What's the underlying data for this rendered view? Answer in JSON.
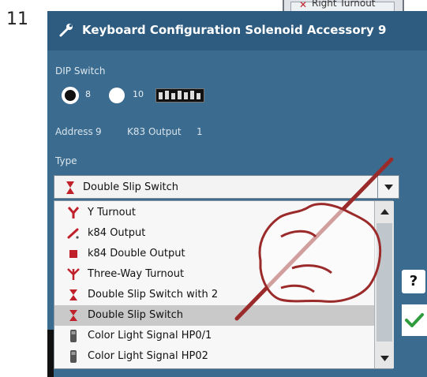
{
  "step_number": "11",
  "background_window": {
    "item_label": "Right Turnout"
  },
  "dialog": {
    "title": "Keyboard Configuration Solenoid Accessory 9",
    "dip_switch": {
      "label": "DIP Switch",
      "option_a": "8",
      "option_b": "10",
      "selected": "8"
    },
    "address_label": "Address",
    "address_value": "9",
    "output_label": "K83 Output",
    "output_value": "1",
    "type_label": "Type",
    "type_selected": "Double Slip Switch",
    "type_options": [
      {
        "label": "Y Turnout",
        "icon": "y-turnout-icon"
      },
      {
        "label": "k84 Output",
        "icon": "k84-output-icon"
      },
      {
        "label": "k84 Double Output",
        "icon": "k84-double-output-icon"
      },
      {
        "label": "Three-Way Turnout",
        "icon": "three-way-turnout-icon"
      },
      {
        "label": "Double Slip Switch with 2",
        "icon": "double-slip-switch-icon"
      },
      {
        "label": "Double Slip Switch",
        "icon": "double-slip-switch-icon",
        "selected": true
      },
      {
        "label": "Color Light Signal HP0/1",
        "icon": "signal-icon"
      },
      {
        "label": "Color Light Signal HP02",
        "icon": "signal-icon"
      }
    ],
    "help_label": "?",
    "colors": {
      "dialog_bg": "#3b6c8f",
      "title_bg": "#2e5c80",
      "accent_red": "#c0202a",
      "ok_green": "#2e9c3c",
      "pen": "#9b2a2a"
    }
  }
}
